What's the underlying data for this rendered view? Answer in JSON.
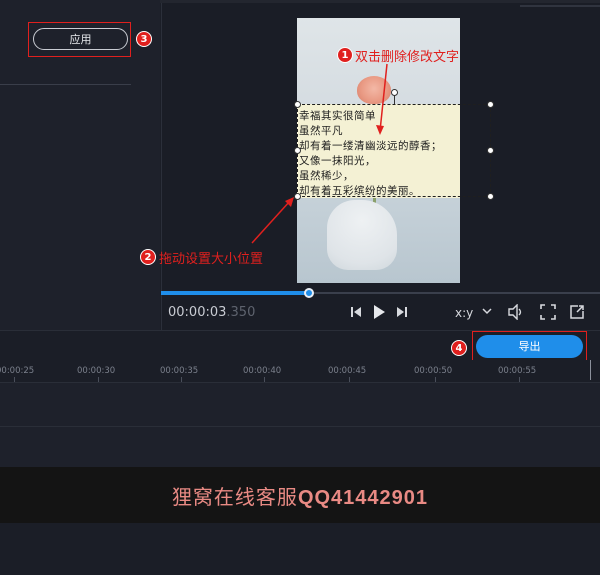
{
  "left_panel": {
    "apply_label": "应用"
  },
  "preview": {
    "caption_lines": [
      "幸福其实很简单",
      "虽然平凡",
      "却有着一缕清幽淡远的醇香；",
      "又像一抹阳光，",
      "虽然稀少，",
      "却有着五彩缤纷的美丽。"
    ]
  },
  "annotations": {
    "step1": {
      "badge": "1",
      "text": "双击删除修改文字"
    },
    "step2": {
      "badge": "2",
      "text": "拖动设置大小位置"
    },
    "step3": {
      "badge": "3"
    },
    "step4": {
      "badge": "4"
    }
  },
  "playback": {
    "time_main": "00:00:03",
    "time_ms": ".350",
    "progress_fraction": 0.34,
    "aspect_label": "x:y",
    "icons": [
      "skip-back-icon",
      "play-icon",
      "skip-forward-icon",
      "chevron-down-icon",
      "volume-icon",
      "fullscreen-icon",
      "popout-icon"
    ]
  },
  "timeline": {
    "export_label": "导出",
    "ticks": [
      "00:00:25",
      "00:00:30",
      "00:00:35",
      "00:00:40",
      "00:00:45",
      "00:00:50",
      "00:00:55"
    ]
  },
  "watermark": {
    "text_cn": "狸窝在线客服",
    "text_qq": "QQ41442901"
  },
  "colors": {
    "accent": "#1f8eea",
    "annotation_red": "#e0201e",
    "watermark": "#e98a84"
  }
}
